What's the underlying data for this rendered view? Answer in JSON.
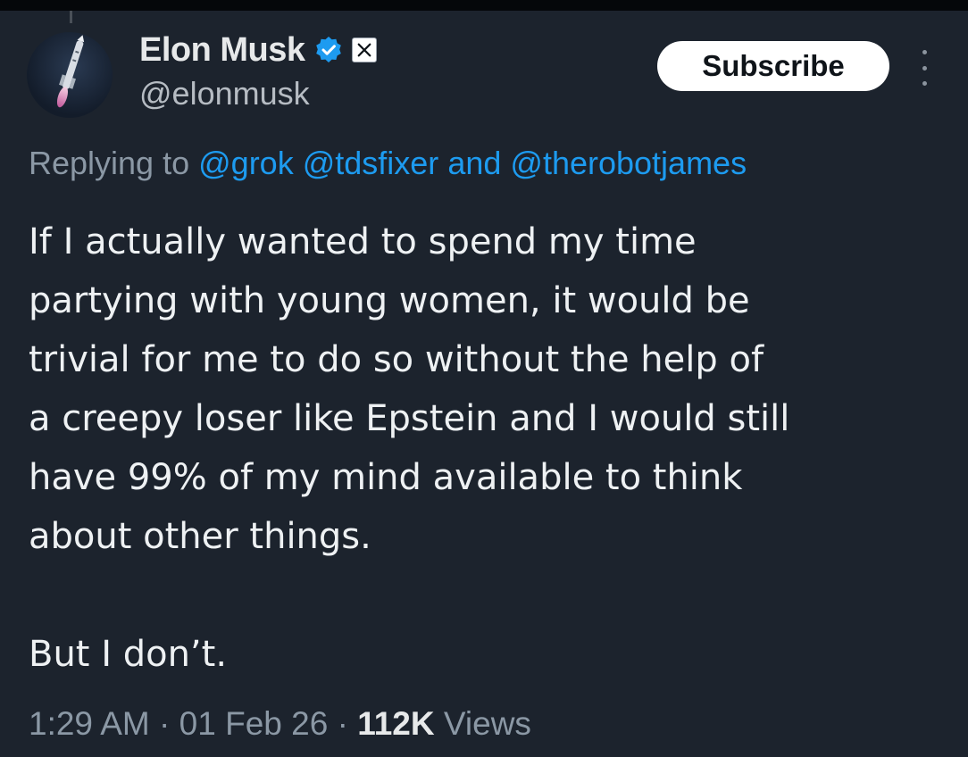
{
  "author": {
    "display_name": "Elon Musk",
    "handle": "@elonmusk",
    "verified_color": "#1d9bf0",
    "avatar_icon": "rocket-icon",
    "affiliation_icon": "x-logo-icon"
  },
  "actions": {
    "subscribe_label": "Subscribe",
    "more_icon": "more-vertical-icon"
  },
  "reply": {
    "prefix": "Replying to",
    "mentions": [
      "@grok",
      "@tdsfixer",
      "@therobotjames"
    ],
    "joiner": "and"
  },
  "tweet": {
    "paragraph_1_lines": [
      "If I actually wanted to spend my time",
      "partying with young women, it would be",
      "trivial for me to do so without the help of",
      "a creepy loser like Epstein and I would still",
      "have 99% of my mind available to think",
      "about other things."
    ],
    "paragraph_2": "But I don’t."
  },
  "meta": {
    "time": "1:29 AM",
    "date": "01 Feb 26",
    "separator": "·",
    "views_count": "112K",
    "views_label": "Views"
  },
  "colors": {
    "background": "#1c232d",
    "text_primary": "#e7e9ea",
    "text_secondary": "#8b98a5",
    "link": "#1d9bf0"
  }
}
